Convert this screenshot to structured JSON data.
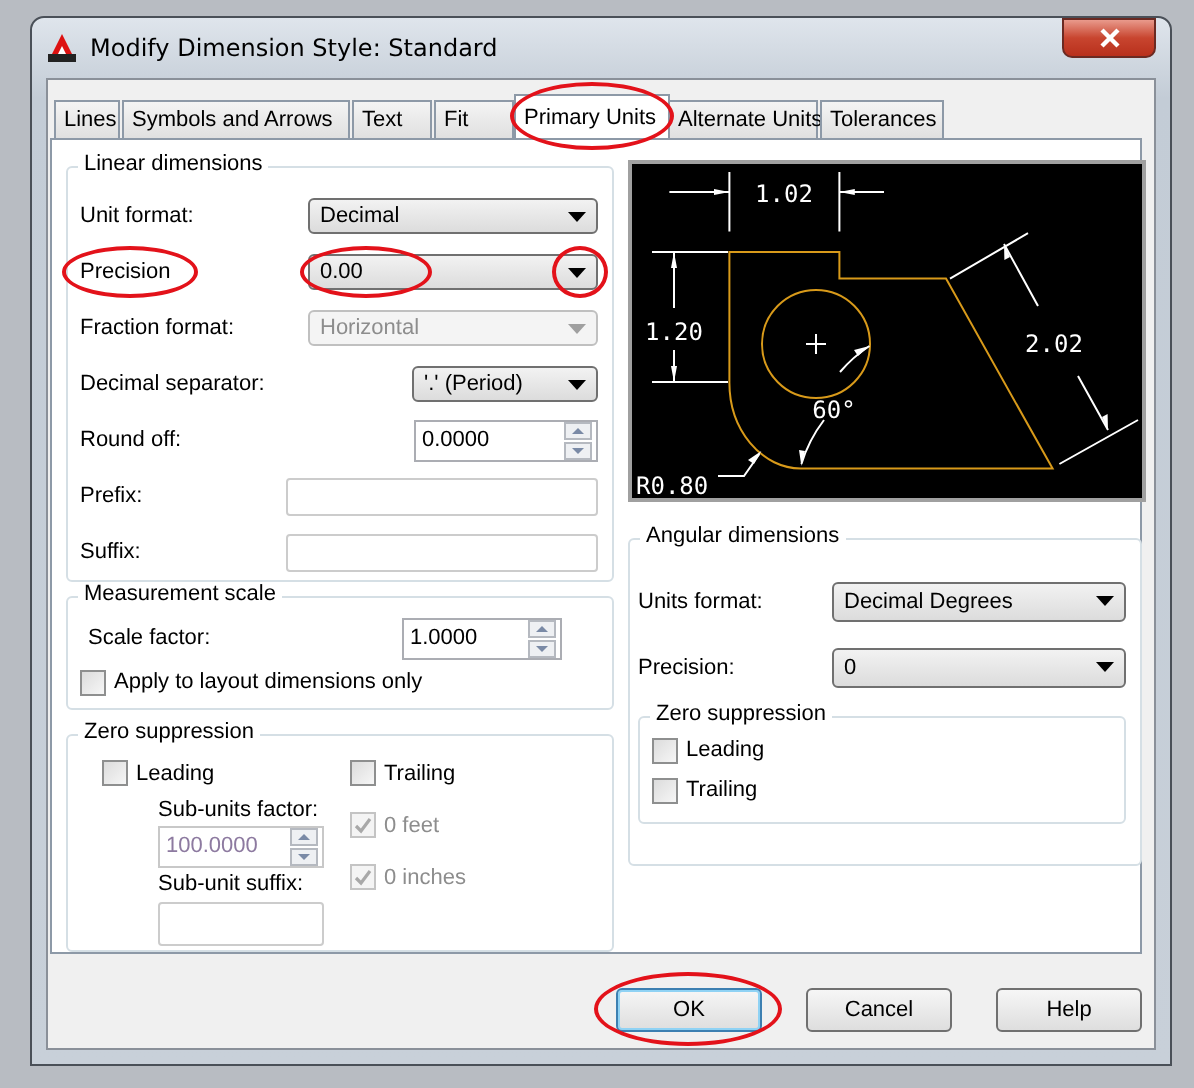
{
  "window": {
    "title": "Modify Dimension Style: Standard"
  },
  "tabs": [
    {
      "label": "Lines",
      "selected": false,
      "highlighted": false
    },
    {
      "label": "Symbols and Arrows",
      "selected": false,
      "highlighted": false
    },
    {
      "label": "Text",
      "selected": false,
      "highlighted": false
    },
    {
      "label": "Fit",
      "selected": false,
      "highlighted": false
    },
    {
      "label": "Primary Units",
      "selected": true,
      "highlighted": true
    },
    {
      "label": "Alternate Units",
      "selected": false,
      "highlighted": false
    },
    {
      "label": "Tolerances",
      "selected": false,
      "highlighted": false
    }
  ],
  "linear_dimensions": {
    "title": "Linear dimensions",
    "fields": [
      {
        "kind": "dropdown",
        "label": "Unit format:",
        "value": "Decimal",
        "disabled": false,
        "highlighted": false
      },
      {
        "kind": "dropdown",
        "label": "Precision",
        "value": "0.00",
        "disabled": false,
        "highlighted": true
      },
      {
        "kind": "dropdown",
        "label": "Fraction format:",
        "value": "Horizontal",
        "disabled": true,
        "highlighted": false
      },
      {
        "kind": "selector",
        "label": "Decimal separator:",
        "value": "'.' (Period)",
        "disabled": false,
        "highlighted": false
      },
      {
        "kind": "spinner",
        "label": "Round off:",
        "value": "0.0000",
        "disabled": false,
        "highlighted": false
      },
      {
        "kind": "text",
        "label": "Prefix:",
        "highlighted": false
      },
      {
        "kind": "text",
        "label": "Suffix:",
        "highlighted": false
      }
    ]
  },
  "measurement_scale": {
    "title": "Measurement scale",
    "scale_factor": {
      "label": "Scale factor:",
      "value": "1.0000"
    },
    "apply_layout": {
      "label": "Apply to layout dimensions only",
      "checked": false
    }
  },
  "zero_suppression": {
    "title": "Zero suppression",
    "leading": {
      "label": "Leading",
      "checked": false,
      "disabled": false
    },
    "trailing": {
      "label": "Trailing",
      "checked": false,
      "disabled": false
    },
    "sub_units_factor": {
      "label": "Sub-units factor:",
      "value": "100.0000",
      "disabled": true
    },
    "sub_unit_suffix": {
      "label": "Sub-unit suffix:"
    },
    "feet": {
      "label": "0 feet",
      "checked": true,
      "disabled": true
    },
    "inches": {
      "label": "0 inches",
      "checked": true,
      "disabled": true
    }
  },
  "preview": {
    "labels": [
      {
        "kind": "top",
        "text": "1.02"
      },
      {
        "kind": "left",
        "text": "1.20"
      },
      {
        "kind": "slant",
        "text": "2.02"
      },
      {
        "kind": "angle",
        "text": "60°"
      },
      {
        "kind": "radius",
        "text": "R0.80"
      }
    ]
  },
  "angular_dimensions": {
    "title": "Angular dimensions",
    "units_format": {
      "label": "Units format:",
      "value": "Decimal Degrees"
    },
    "precision": {
      "label": "Precision:",
      "value": "0"
    },
    "zero_suppression": {
      "title": "Zero suppression",
      "options": [
        {
          "label": "Leading",
          "checked": false
        },
        {
          "label": "Trailing",
          "checked": false
        }
      ]
    }
  },
  "buttons": [
    {
      "label": "OK",
      "default": true,
      "highlighted": true
    },
    {
      "label": "Cancel",
      "default": false,
      "highlighted": false
    },
    {
      "label": "Help",
      "default": false,
      "highlighted": false
    }
  ]
}
